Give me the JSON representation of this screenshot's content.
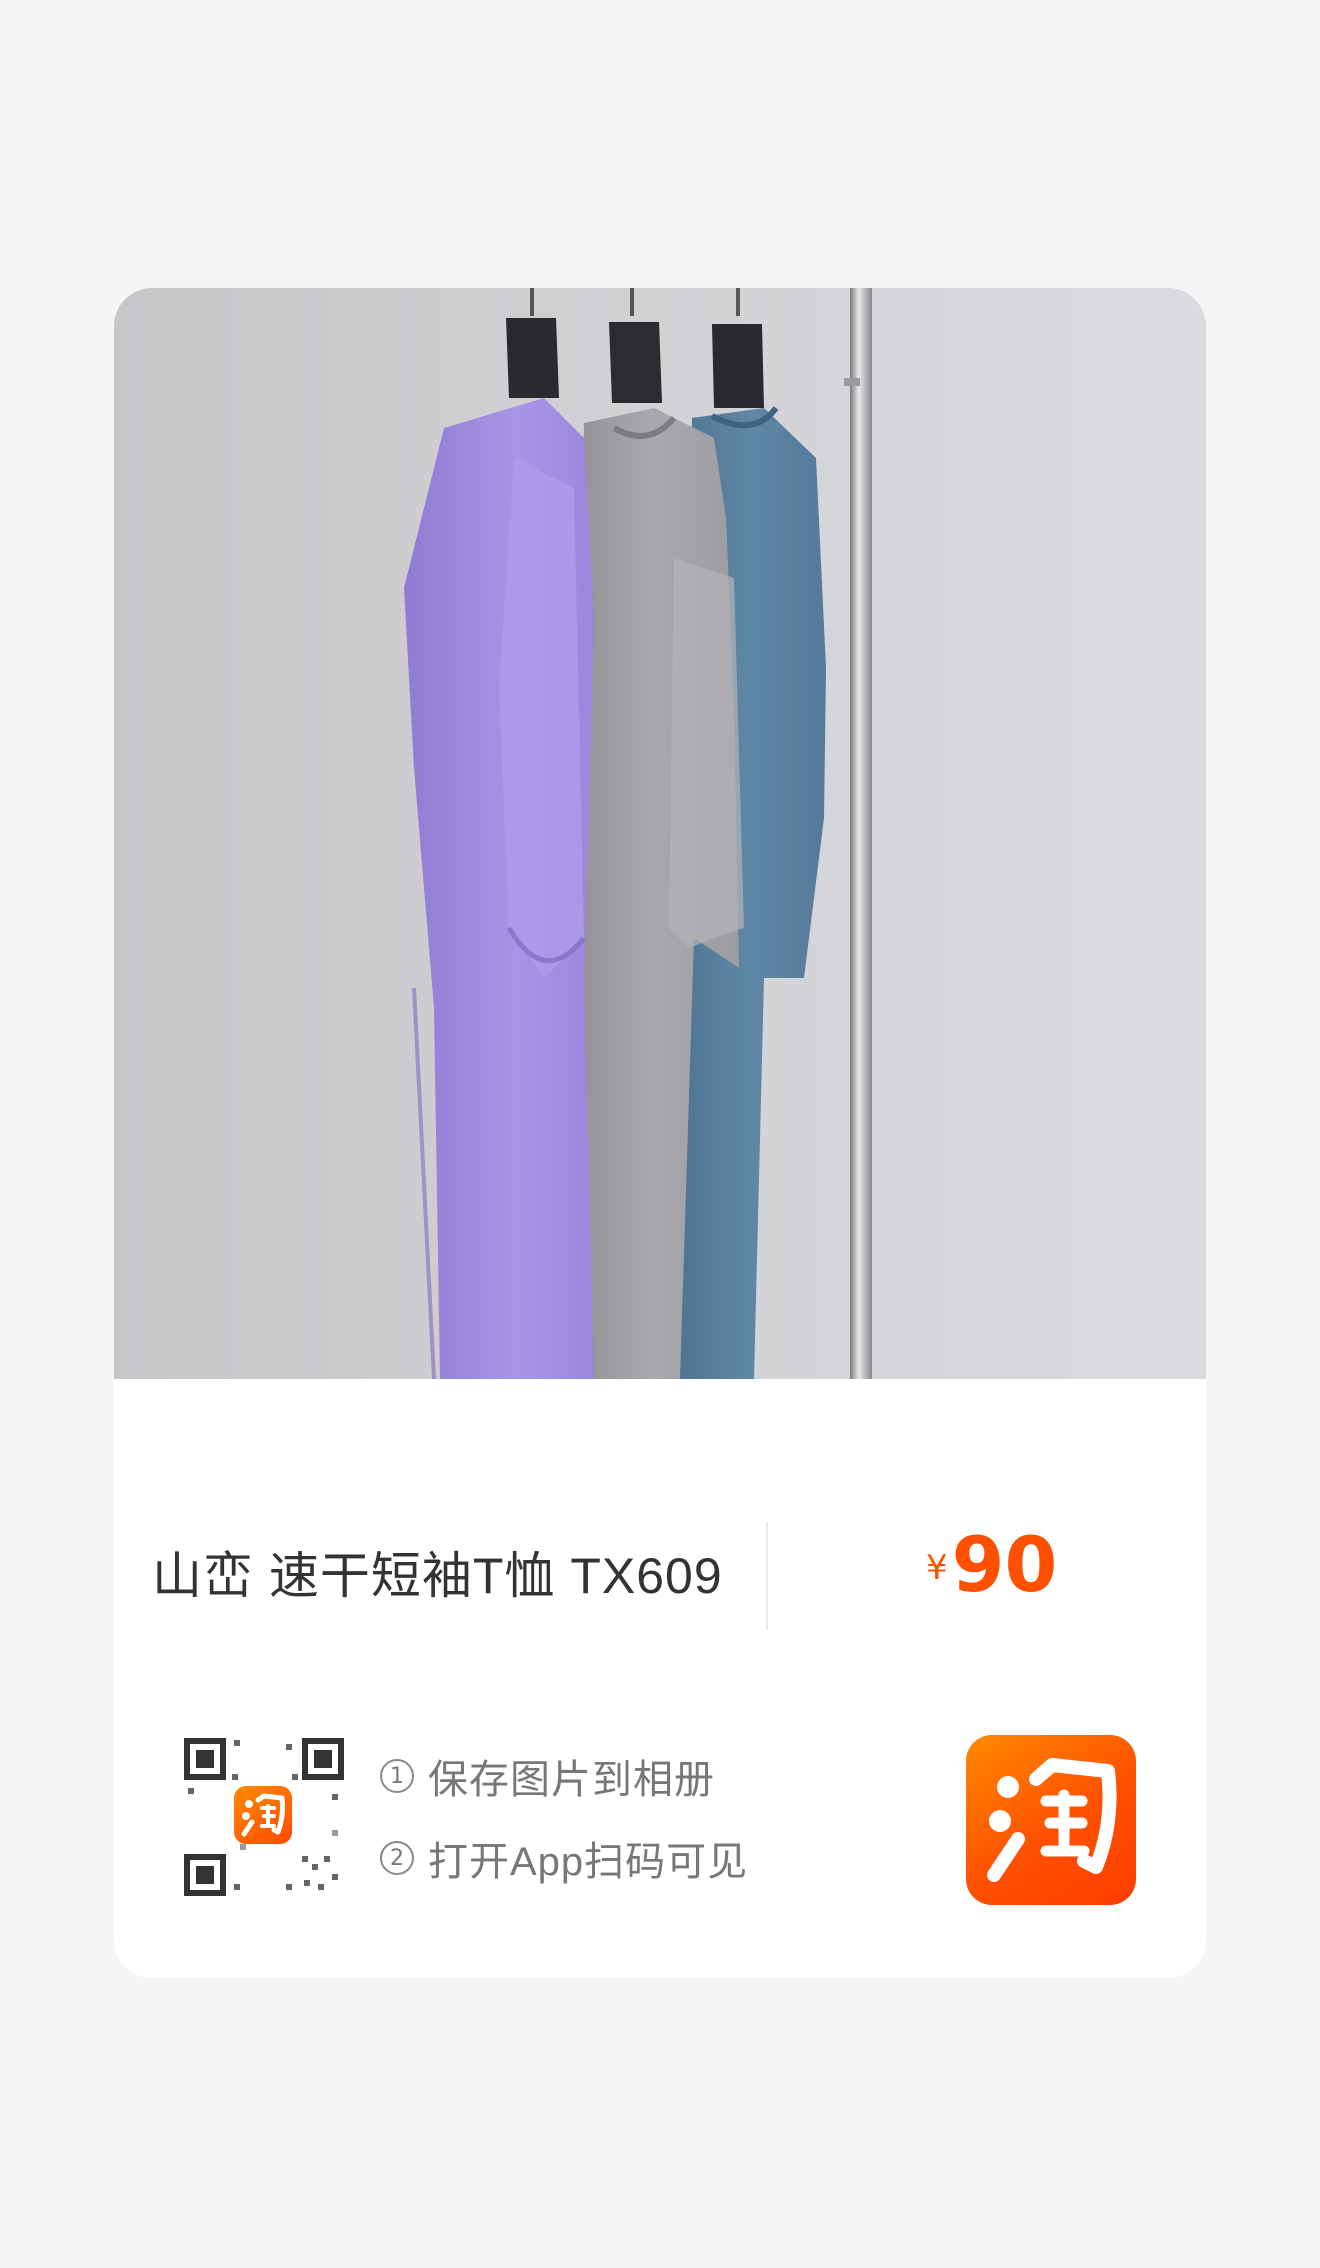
{
  "product": {
    "title": "山峦 速干短袖T恤 TX609",
    "currency_symbol": "¥",
    "price": "90",
    "price_color": "#ff5000"
  },
  "photo": {
    "description_icon": "product-photo-tshirts"
  },
  "qr": {
    "icon": "qr-code-icon",
    "badge_icon": "taobao-badge-icon"
  },
  "instructions": [
    {
      "num": "1",
      "text": "保存图片到相册"
    },
    {
      "num": "2",
      "text": "打开App扫码可见"
    }
  ],
  "app": {
    "icon": "taobao-app-icon",
    "brand_color": "#ff5000"
  }
}
